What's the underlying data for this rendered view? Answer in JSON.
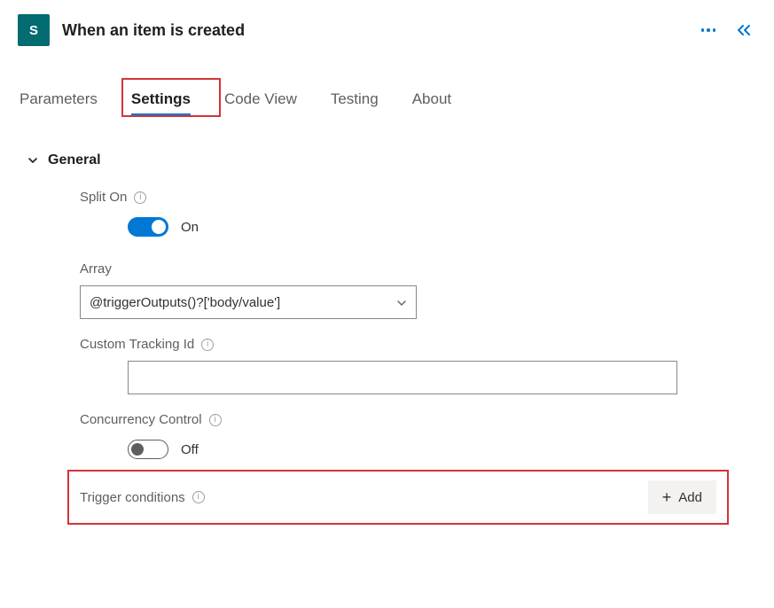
{
  "header": {
    "icon_letter": "S",
    "title": "When an item is created"
  },
  "tabs": {
    "items": [
      {
        "label": "Parameters"
      },
      {
        "label": "Settings"
      },
      {
        "label": "Code View"
      },
      {
        "label": "Testing"
      },
      {
        "label": "About"
      }
    ],
    "active_index": 1
  },
  "section": {
    "title": "General",
    "split_on": {
      "label": "Split On",
      "state_label": "On",
      "value": true
    },
    "array": {
      "label": "Array",
      "value": "@triggerOutputs()?['body/value']"
    },
    "custom_tracking": {
      "label": "Custom Tracking Id",
      "value": ""
    },
    "concurrency": {
      "label": "Concurrency Control",
      "state_label": "Off",
      "value": false
    },
    "trigger_conditions": {
      "label": "Trigger conditions",
      "add_label": "Add"
    }
  },
  "colors": {
    "accent": "#0078d4",
    "highlight": "#d13438",
    "app_icon_bg": "#036c70"
  }
}
